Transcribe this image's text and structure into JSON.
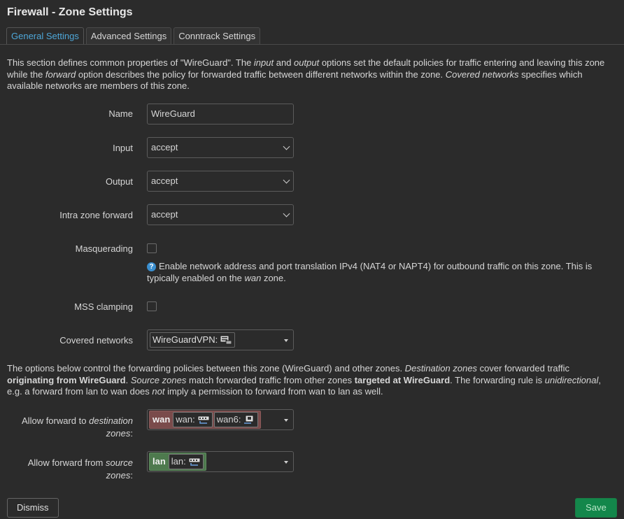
{
  "title": "Firewall - Zone Settings",
  "tabs": [
    {
      "label": "General Settings",
      "active": true
    },
    {
      "label": "Advanced Settings",
      "active": false
    },
    {
      "label": "Conntrack Settings",
      "active": false
    }
  ],
  "intro": {
    "p1": "This section defines common properties of \"WireGuard\". The ",
    "input": "input",
    "p2": " and ",
    "output": "output",
    "p3": " options set the default policies for traffic entering and leaving this zone while the ",
    "forward": "forward",
    "p4": " option describes the policy for forwarded traffic between different networks within the zone. ",
    "covered": "Covered networks",
    "p5": " specifies which available networks are members of this zone."
  },
  "form": {
    "name_label": "Name",
    "name_value": "WireGuard",
    "input_label": "Input",
    "input_value": "accept",
    "output_label": "Output",
    "output_value": "accept",
    "intra_label": "Intra zone forward",
    "intra_value": "accept",
    "masq_label": "Masquerading",
    "masq_checked": false,
    "masq_help_1": "Enable network address and port translation IPv4 (NAT4 or NAPT4) for outbound traffic on this zone. This is typically enabled on the ",
    "masq_help_wan": "wan",
    "masq_help_2": " zone.",
    "mss_label": "MSS clamping",
    "mss_checked": false,
    "covered_label": "Covered networks",
    "covered_value": "WireGuardVPN:"
  },
  "forwarding": {
    "p1": "The options below control the forwarding policies between this zone (WireGuard) and other zones. ",
    "dest_zones": "Destination zones",
    "p2": " cover forwarded traffic ",
    "orig": "originating from WireGuard",
    "p3": ". ",
    "src_zones": "Source zones",
    "p4": " match forwarded traffic from other zones ",
    "targ": "targeted at WireGuard",
    "p5": ". The forwarding rule is ",
    "unidir": "unidirectional",
    "p6": ", e.g. a forward from lan to wan does ",
    "not": "not",
    "p7": " imply a permission to forward from wan to lan as well.",
    "dest_label_a": "Allow forward to ",
    "dest_label_em": "destination",
    "dest_label_b": "zones",
    "dest_label_colon": ":",
    "dest_zone": {
      "name": "wan",
      "color": "#7a4b4b",
      "nets": [
        "wan:",
        "wan6:"
      ]
    },
    "src_label_a": "Allow forward from ",
    "src_label_em": "source",
    "src_label_b": "zones",
    "src_label_colon": ":",
    "src_zone": {
      "name": "lan",
      "color": "#4e7a4e",
      "nets": [
        "lan:"
      ]
    }
  },
  "buttons": {
    "dismiss": "Dismiss",
    "save": "Save"
  },
  "colors": {
    "accent": "#4ea7d8",
    "save_bg": "#13874b",
    "wan_zone": "#7a4b4b",
    "lan_zone": "#4e7a4e"
  }
}
